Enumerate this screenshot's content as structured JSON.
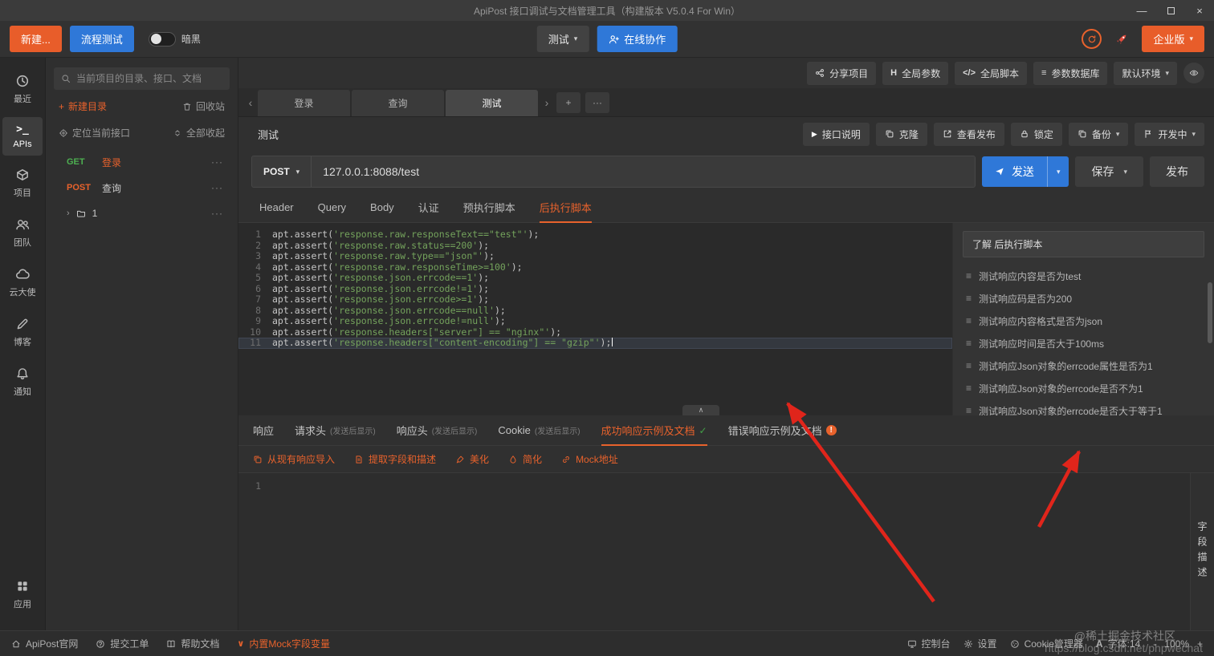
{
  "titlebar": {
    "title": "ApiPost 接口调试与文档管理工具（构建版本 V5.0.4 For Win）"
  },
  "toolbar": {
    "new_label": "新建...",
    "flow_label": "流程测试",
    "dark_label": "暗黑",
    "env_value": "测试",
    "collab_label": "在线协作",
    "enterprise_label": "企业版"
  },
  "rail": {
    "items": [
      {
        "label": "最近"
      },
      {
        "label": "APIs"
      },
      {
        "label": "项目"
      },
      {
        "label": "团队"
      },
      {
        "label": "云大使"
      },
      {
        "label": "博客"
      },
      {
        "label": "通知"
      }
    ],
    "bottom": {
      "label": "应用"
    }
  },
  "sidebar": {
    "search_placeholder": "当前项目的目录、接口、文档",
    "new_dir": "新建目录",
    "recycle": "回收站",
    "locate": "定位当前接口",
    "collapse_all": "全部收起",
    "tree": [
      {
        "method": "GET",
        "name": "登录"
      },
      {
        "method": "POST",
        "name": "查询"
      },
      {
        "name": "1"
      }
    ]
  },
  "project_toolbar": {
    "share": "分享项目",
    "global_params": "全局参数",
    "global_params_icon": "H",
    "global_script": "全局脚本",
    "global_script_icon": "</>",
    "param_db": "参数数据库",
    "default_env": "默认环境"
  },
  "tabstrip": {
    "tabs": [
      "登录",
      "查询",
      "测试"
    ]
  },
  "api_header": {
    "title": "测试",
    "doc": "接口说明",
    "clone": "克隆",
    "view_publish": "查看发布",
    "lock": "锁定",
    "backup": "备份",
    "status": "开发中"
  },
  "request": {
    "method": "POST",
    "url": "127.0.0.1:8088/test",
    "send": "发送",
    "save": "保存",
    "publish": "发布",
    "tabs": [
      "Header",
      "Query",
      "Body",
      "认证",
      "预执行脚本",
      "后执行脚本"
    ]
  },
  "code": {
    "prefix": "apt.assert(",
    "suffix": ");",
    "active_line": 11,
    "lines": [
      "'response.raw.responseText==\"test\"'",
      "'response.raw.status==200'",
      "'response.raw.type==\"json\"'",
      "'response.raw.responseTime>=100'",
      "'response.json.errcode==1'",
      "'response.json.errcode!=1'",
      "'response.json.errcode>=1'",
      "'response.json.errcode==null'",
      "'response.json.errcode!=null'",
      "'response.headers[\"server\"] == \"nginx\"'",
      "'response.headers[\"content-encoding\"] == \"gzip\"'"
    ]
  },
  "help": {
    "title": "了解 后执行脚本",
    "items": [
      "测试响应内容是否为test",
      "测试响应码是否为200",
      "测试响应内容格式是否为json",
      "测试响应时间是否大于100ms",
      "测试响应Json对象的errcode属性是否为1",
      "测试响应Json对象的errcode是否不为1",
      "测试响应Json对象的errcode是否大于等于1"
    ]
  },
  "response": {
    "tabs": [
      {
        "label": "响应",
        "note": ""
      },
      {
        "label": "请求头",
        "note": "(发送后显示)"
      },
      {
        "label": "响应头",
        "note": "(发送后显示)"
      },
      {
        "label": "Cookie",
        "note": "(发送后显示)"
      },
      {
        "label": "成功响应示例及文档",
        "note": ""
      },
      {
        "label": "错误响应示例及文档",
        "note": ""
      }
    ],
    "warn_badge": "!",
    "tools": [
      "从现有响应导入",
      "提取字段和描述",
      "美化",
      "简化",
      "Mock地址"
    ],
    "line_no": "1",
    "side_label": "字段描述"
  },
  "statusbar": {
    "home": "ApiPost官网",
    "ticket": "提交工单",
    "docs": "帮助文档",
    "mock": "内置Mock字段变量",
    "console": "控制台",
    "settings": "设置",
    "cookie": "Cookie管理器",
    "font": "字体:14",
    "zoom": "100%",
    "zoom_out": "-",
    "zoom_in": "+"
  },
  "watermarks": {
    "juejin": "@稀土掘金技术社区",
    "csdn": "https://blog.csdn.net/phpwechat"
  }
}
